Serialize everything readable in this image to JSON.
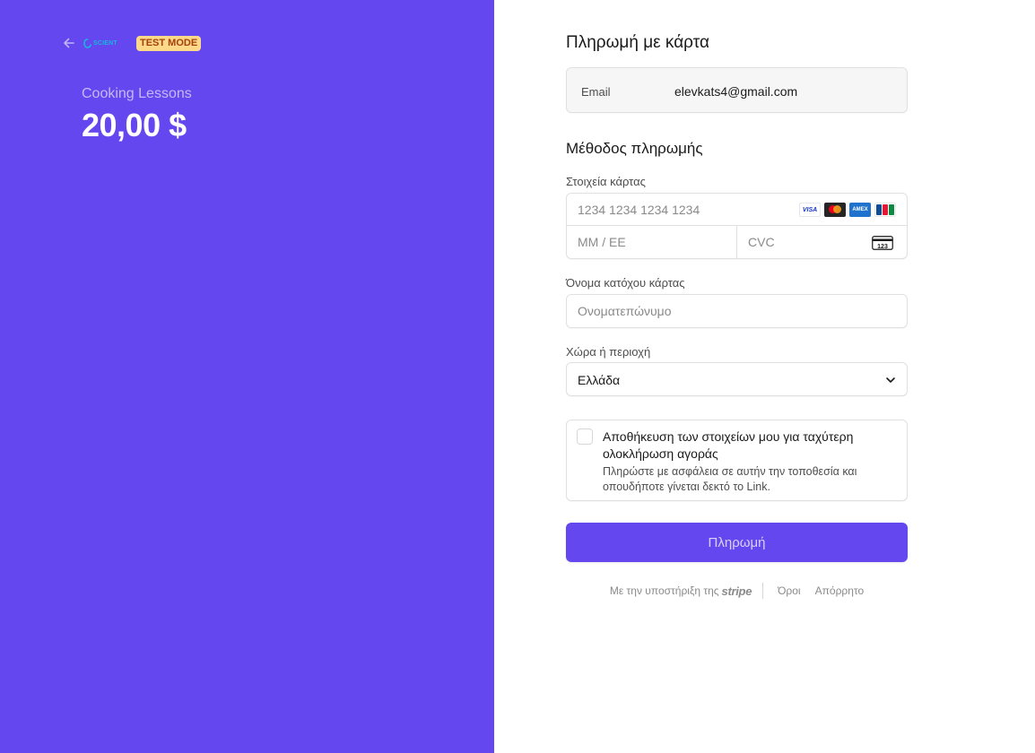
{
  "left": {
    "test_badge": "TEST MODE",
    "product_name": "Cooking Lessons",
    "price": "20,00 $"
  },
  "form": {
    "title": "Πληρωμή με κάρτα",
    "email": {
      "label": "Email",
      "value": "elevkats4@gmail.com"
    },
    "method_title": "Μέθοδος πληρωμής",
    "card": {
      "label": "Στοιχεία κάρτας",
      "number_placeholder": "1234 1234 1234 1234",
      "expiry_placeholder": "MM / ΕΕ",
      "cvc_placeholder": "CVC",
      "brands": {
        "visa": "VISA",
        "amex": "AMEX"
      },
      "cvc_icon_text": "123"
    },
    "cardholder": {
      "label": "Όνομα κατόχου κάρτας",
      "placeholder": "Ονοματεπώνυμο"
    },
    "country": {
      "label": "Χώρα ή περιοχή",
      "value": "Ελλάδα"
    },
    "save": {
      "title": "Αποθήκευση των στοιχείων μου για ταχύτερη ολοκλήρωση αγοράς",
      "description": "Πληρώστε με ασφάλεια σε αυτήν την τοποθεσία και οπουδήποτε γίνεται δεκτό το Link."
    },
    "pay_button": "Πληρωμή"
  },
  "footer": {
    "powered_by": "Με την υποστήριξη της",
    "stripe": "stripe",
    "terms": "Όροι",
    "privacy": "Απόρρητο"
  },
  "colors": {
    "brand": "#6447ee",
    "badge_bg": "#fed98a",
    "badge_text": "#a2410e"
  }
}
